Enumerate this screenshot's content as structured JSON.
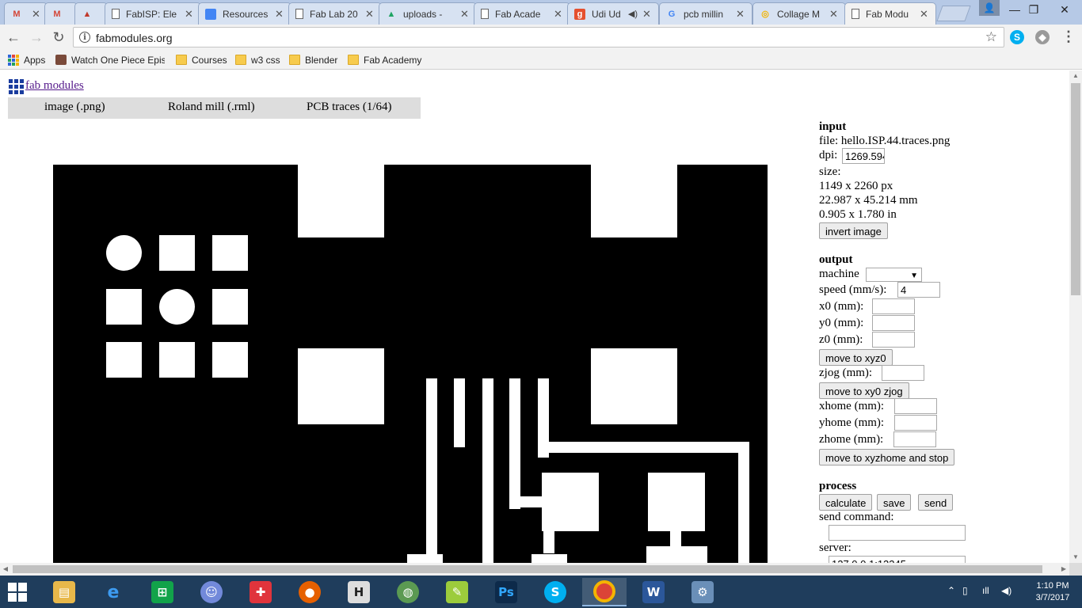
{
  "browser": {
    "tabs": [
      {
        "label": "",
        "icon": "gmail-icon"
      },
      {
        "label": "",
        "icon": "gmail-icon"
      },
      {
        "label": "",
        "icon": "app-icon"
      },
      {
        "label": "FabISP: Ele",
        "icon": "document-icon"
      },
      {
        "label": "Resources",
        "icon": "google-docs-icon"
      },
      {
        "label": "Fab Lab 20",
        "icon": "document-icon"
      },
      {
        "label": "uploads -",
        "icon": "google-drive-icon"
      },
      {
        "label": "Fab Acade",
        "icon": "document-icon"
      },
      {
        "label": "Udi Ud",
        "icon": "udi-icon"
      },
      {
        "label": "pcb millin",
        "icon": "google-icon"
      },
      {
        "label": "Collage M",
        "icon": "collage-icon"
      },
      {
        "label": "Fab Modu",
        "icon": "document-icon",
        "active": true
      }
    ],
    "url": "fabmodules.org",
    "bookmarks": [
      {
        "label": "Apps",
        "icon": "apps-grid-icon"
      },
      {
        "label": "Watch One Piece Epis",
        "icon": "one-piece-icon"
      },
      {
        "label": "Courses",
        "icon": "folder-icon"
      },
      {
        "label": "w3 css",
        "icon": "folder-icon"
      },
      {
        "label": "Blender",
        "icon": "folder-icon"
      },
      {
        "label": "Fab Academy",
        "icon": "folder-icon"
      }
    ]
  },
  "page": {
    "title_link": "fab modules",
    "menu": [
      "image (.png)",
      "Roland mill (.rml)",
      "PCB traces (1/64)"
    ]
  },
  "panel": {
    "input": {
      "heading": "input",
      "file": "file: hello.ISP.44.traces.png",
      "dpi_label": "dpi:",
      "dpi_value": "1269.594",
      "size_label": "size:",
      "size_px": "1149 x 2260 px",
      "size_mm": "22.987 x 45.214 mm",
      "size_in": "0.905 x 1.780 in",
      "invert_button": "invert image"
    },
    "output": {
      "heading": "output",
      "machine_label": "machine",
      "machine_value": "",
      "speed_label": "speed (mm/s):",
      "speed_value": "4",
      "x0_label": "x0 (mm):",
      "y0_label": "y0 (mm):",
      "z0_label": "z0 (mm):",
      "move_xyz0": "move to xyz0",
      "zjog_label": "zjog (mm):",
      "move_xy0_zjog": "move to xy0 zjog",
      "xhome_label": "xhome (mm):",
      "yhome_label": "yhome (mm):",
      "zhome_label": "zhome (mm):",
      "move_home": "move to xyzhome and stop"
    },
    "process": {
      "heading": "process",
      "calculate": "calculate",
      "save": "save",
      "send": "send",
      "send_command_label": "send command:",
      "send_command_value": "",
      "server_label": "server:",
      "server_value": "127.0.0.1:12345"
    }
  },
  "taskbar": {
    "clock_time": "1:10 PM",
    "clock_date": "3/7/2017"
  }
}
